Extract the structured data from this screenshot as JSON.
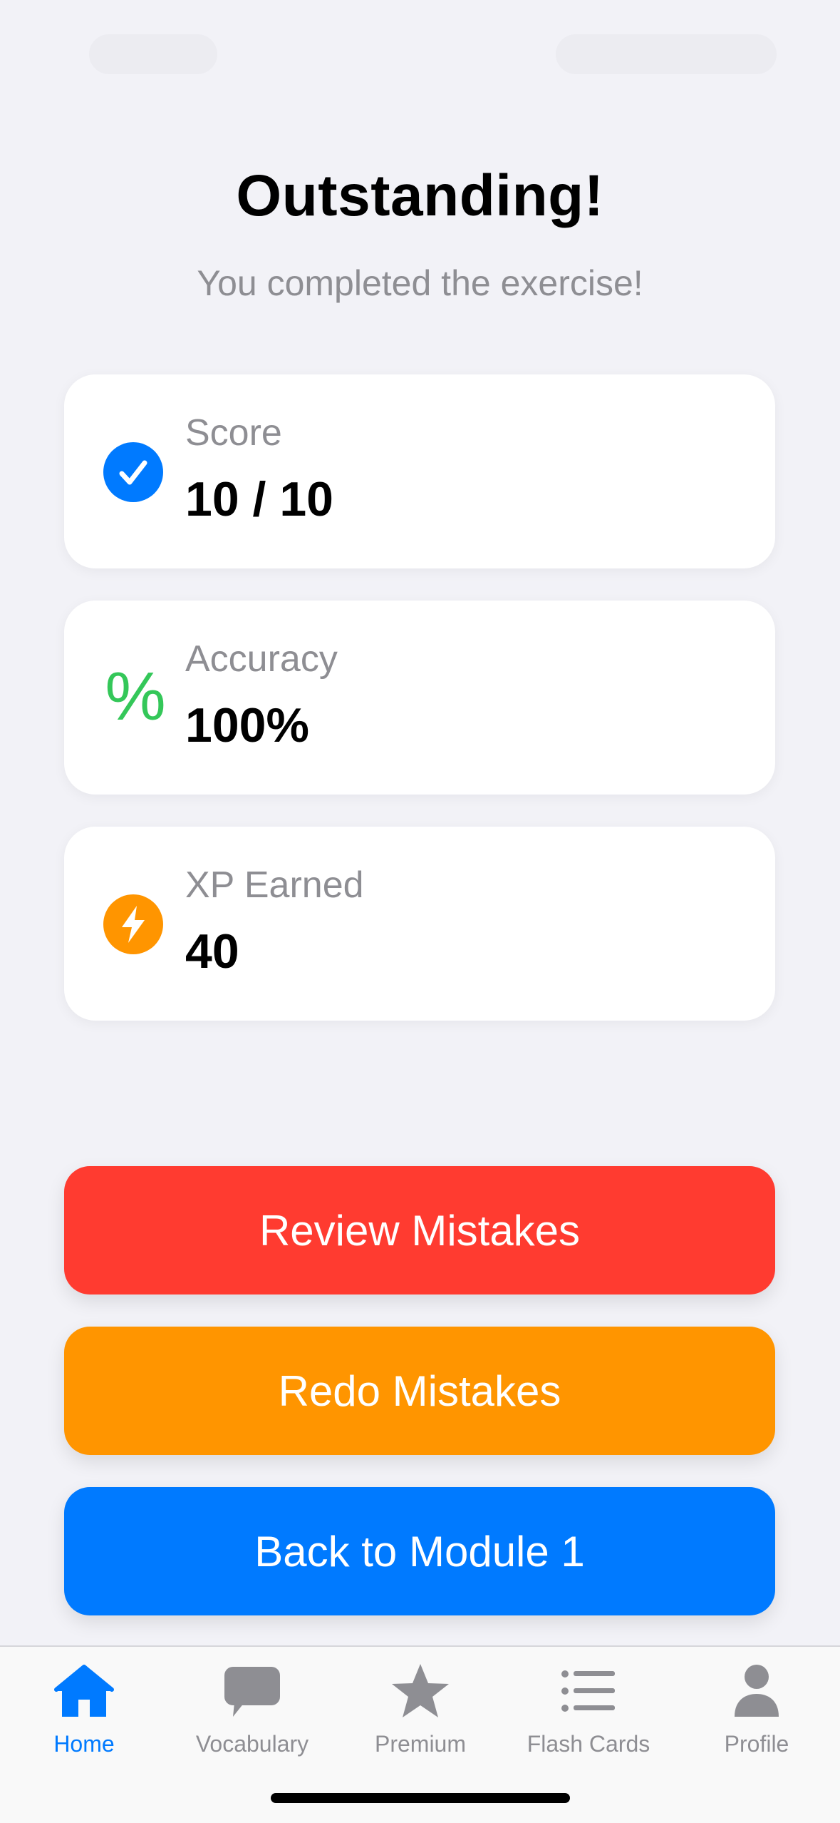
{
  "header": {
    "title": "Outstanding!",
    "subtitle": "You completed the exercise!"
  },
  "stats": [
    {
      "label": "Score",
      "value": "10 / 10",
      "icon": "checkmark-circle-icon",
      "color": "#007AFF"
    },
    {
      "label": "Accuracy",
      "value": "100%",
      "icon": "percent-icon",
      "icon_glyph": "%",
      "color": "#34C759"
    },
    {
      "label": "XP Earned",
      "value": "40",
      "icon": "bolt-circle-icon",
      "color": "#FF9500"
    }
  ],
  "actions": {
    "review": {
      "label": "Review Mistakes",
      "color": "#FF3B30"
    },
    "redo": {
      "label": "Redo Mistakes",
      "color": "#FF9500"
    },
    "back": {
      "label": "Back to Module 1",
      "color": "#007AFF"
    }
  },
  "tabs": [
    {
      "label": "Home",
      "icon": "house-icon",
      "active": true
    },
    {
      "label": "Vocabulary",
      "icon": "speech-bubble-icon",
      "active": false
    },
    {
      "label": "Premium",
      "icon": "star-icon",
      "active": false
    },
    {
      "label": "Flash Cards",
      "icon": "list-icon",
      "active": false
    },
    {
      "label": "Profile",
      "icon": "person-icon",
      "active": false
    }
  ],
  "colors": {
    "background": "#F2F2F7",
    "active_tab": "#007AFF",
    "inactive_tab": "#8E8E93"
  }
}
